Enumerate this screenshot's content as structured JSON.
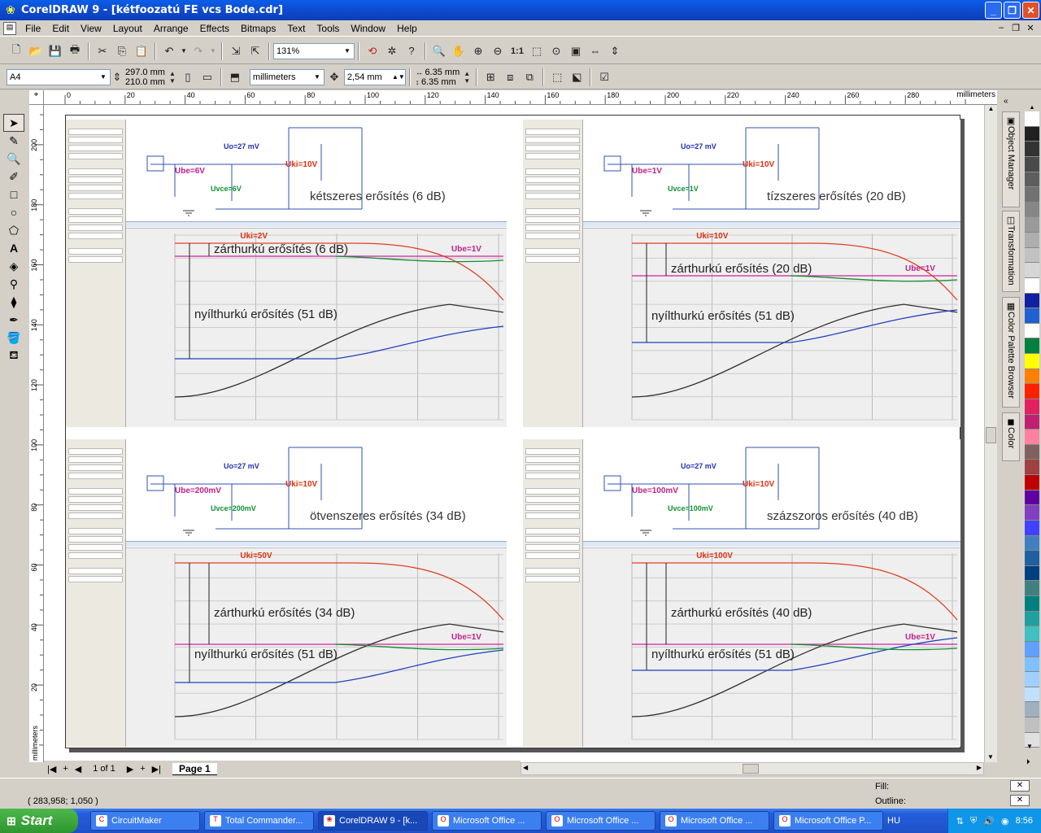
{
  "window": {
    "title": "CorelDRAW 9 - [kétfoozatú FE vcs Bode.cdr]"
  },
  "menu": [
    "File",
    "Edit",
    "View",
    "Layout",
    "Arrange",
    "Effects",
    "Bitmaps",
    "Text",
    "Tools",
    "Window",
    "Help"
  ],
  "toolbar": {
    "zoom": "131%"
  },
  "propbar": {
    "paper": "A4",
    "width": "297.0 mm",
    "height": "210.0 mm",
    "units": "millimeters",
    "nudge": "2,54 mm",
    "dup_x": "6.35 mm",
    "dup_y": "6.35 mm"
  },
  "ruler": {
    "unit": "millimeters",
    "h_ticks": [
      "0",
      "20",
      "40",
      "60",
      "80",
      "100",
      "120",
      "140",
      "160",
      "180",
      "200",
      "220",
      "240",
      "260",
      "280"
    ],
    "v_ticks": [
      "200",
      "180",
      "160",
      "140",
      "120",
      "100",
      "80",
      "60",
      "40",
      "20"
    ],
    "v_unit": "millimeters"
  },
  "panels": [
    {
      "caption": "kétszeres erősítés (6 dB)",
      "uki": "Uki=2V",
      "ube": "Ube=1V",
      "closed": "zárthurkú erősítés (6 dB)",
      "open": "nyílthurkú erősítés (51 dB)",
      "uo": "Uo=27 mV",
      "ube_s": "Ube=6V",
      "uvce": "Uvce=6V",
      "uki_s": "Uki=10V"
    },
    {
      "caption": "tízszeres erősítés (20 dB)",
      "uki": "Uki=10V",
      "ube": "Ube=1V",
      "closed": "zárthurkú erősítés (20 dB)",
      "open": "nyílthurkú erősítés (51 dB)",
      "uo": "Uo=27 mV",
      "ube_s": "Ube=1V",
      "uvce": "Uvce=1V",
      "uki_s": "Uki=10V"
    },
    {
      "caption": "ötvenszeres erősítés (34 dB)",
      "uki": "Uki=50V",
      "ube": "Ube=1V",
      "closed": "zárthurkú erősítés (34 dB)",
      "open": "nyílthurkú erősítés (51 dB)",
      "uo": "Uo=27 mV",
      "ube_s": "Ube=200mV",
      "uvce": "Uvce=200mV",
      "uki_s": "Uki=10V"
    },
    {
      "caption": "százszoros erősítés (40 dB)",
      "uki": "Uki=100V",
      "ube": "Ube=1V",
      "closed": "zárthurkú erősítés (40 dB)",
      "open": "nyílthurkú erősítés (51 dB)",
      "uo": "Uo=27 mV",
      "ube_s": "Ube=100mV",
      "uvce": "Uvce=100mV",
      "uki_s": "Uki=10V"
    }
  ],
  "pagenav": {
    "count": "1 of 1",
    "tab": "Page 1"
  },
  "dockers": [
    "Object Manager",
    "Transformation",
    "Color Palette Browser",
    "Color"
  ],
  "palette": [
    "#ffffff",
    "#202020",
    "#333333",
    "#4a4a4a",
    "#5e5e5e",
    "#727272",
    "#868686",
    "#9a9a9a",
    "#aeaeae",
    "#c2c2c2",
    "#d6d6d6",
    "#ffffff",
    "#1020a0",
    "#2060d0",
    "#ffffff",
    "#008040",
    "#ffff00",
    "#ff8000",
    "#ff2000",
    "#e02060",
    "#c02070",
    "#ff80a0",
    "#806060",
    "#a04040",
    "#c00000",
    "#6000a0",
    "#8040c0",
    "#4040ff",
    "#4080c0",
    "#2060a0",
    "#004080",
    "#408080",
    "#008080",
    "#20a0a0",
    "#40c0c0",
    "#60a0ff",
    "#80c0ff",
    "#a0d0ff",
    "#c0e0ff",
    "#a0b0c0",
    "#c0c0c0",
    "#e0e0e0"
  ],
  "status": {
    "coords": "( 283,958; 1,050 )",
    "fill": "Fill:",
    "outline": "Outline:"
  },
  "taskbar": {
    "start": "Start",
    "tasks": [
      "CircuitMaker",
      "Total Commander...",
      "CorelDRAW 9 - [k...",
      "Microsoft Office ...",
      "Microsoft Office ...",
      "Microsoft Office ...",
      "Microsoft Office P..."
    ],
    "lang": "HU",
    "clock": "8:56"
  }
}
